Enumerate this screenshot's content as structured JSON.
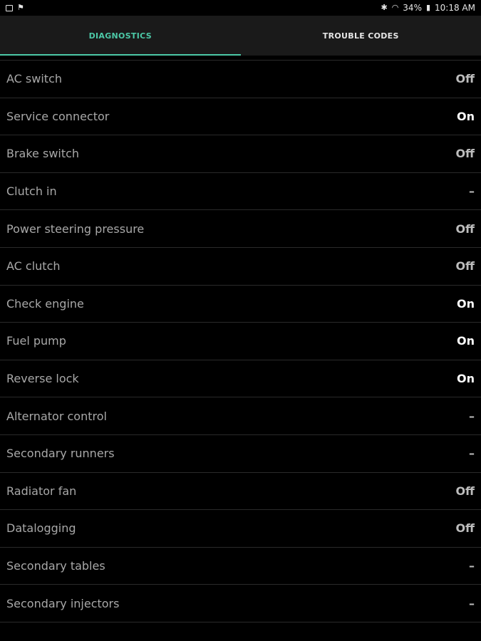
{
  "status_bar": {
    "battery": "34%",
    "time": "10:18 AM"
  },
  "tabs": [
    {
      "label": "DIAGNOSTICS",
      "active": true
    },
    {
      "label": "TROUBLE CODES",
      "active": false
    }
  ],
  "colors": {
    "accent": "#4cc9a7",
    "background": "#000000",
    "tab_bar": "#1a1a1a"
  },
  "rows": [
    {
      "label": "AC switch",
      "value": "Off"
    },
    {
      "label": "Service connector",
      "value": "On"
    },
    {
      "label": "Brake switch",
      "value": "Off"
    },
    {
      "label": "Clutch in",
      "value": "–"
    },
    {
      "label": "Power steering pressure",
      "value": "Off"
    },
    {
      "label": "AC clutch",
      "value": "Off"
    },
    {
      "label": "Check engine",
      "value": "On"
    },
    {
      "label": "Fuel pump",
      "value": "On"
    },
    {
      "label": "Reverse lock",
      "value": "On"
    },
    {
      "label": "Alternator control",
      "value": "–"
    },
    {
      "label": "Secondary runners",
      "value": "–"
    },
    {
      "label": "Radiator fan",
      "value": "Off"
    },
    {
      "label": "Datalogging",
      "value": "Off"
    },
    {
      "label": "Secondary tables",
      "value": "–"
    },
    {
      "label": "Secondary injectors",
      "value": "–"
    }
  ]
}
